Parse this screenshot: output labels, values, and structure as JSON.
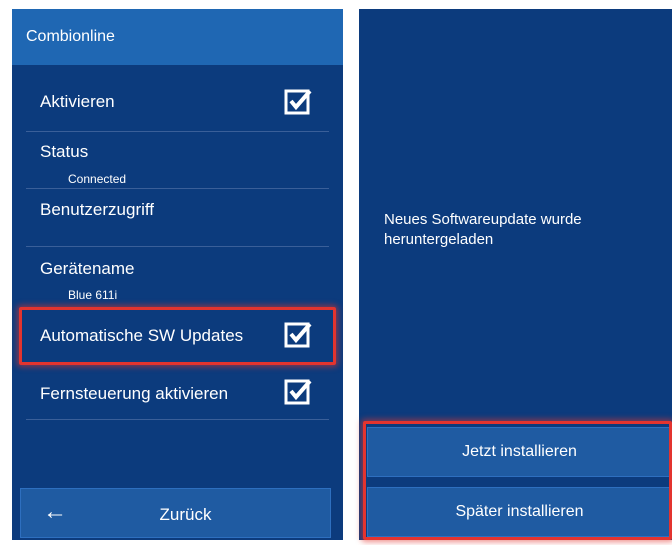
{
  "left_panel": {
    "header": "Combionline",
    "items": [
      {
        "label": "Aktivieren",
        "checked": true
      },
      {
        "label": "Status",
        "sub": "Connected"
      },
      {
        "label": "Benutzerzugriff"
      },
      {
        "label": "Gerätename",
        "sub": "Blue 611i"
      },
      {
        "label": "Automatische SW Updates",
        "checked": true
      },
      {
        "label": "Fernsteuerung aktivieren",
        "checked": true
      }
    ],
    "back_button": {
      "label": "Zurück",
      "icon": "arrow-left-icon"
    }
  },
  "right_panel": {
    "message": "Neues Softwareupdate wurde heruntergeladen",
    "buttons": [
      {
        "label": "Jetzt installieren"
      },
      {
        "label": "Später installieren"
      }
    ]
  },
  "colors": {
    "panel_bg": "#0c3b7d",
    "header_bg": "#1f67b3",
    "button_bg": "#1f5ba2",
    "highlight": "#e3342f"
  }
}
